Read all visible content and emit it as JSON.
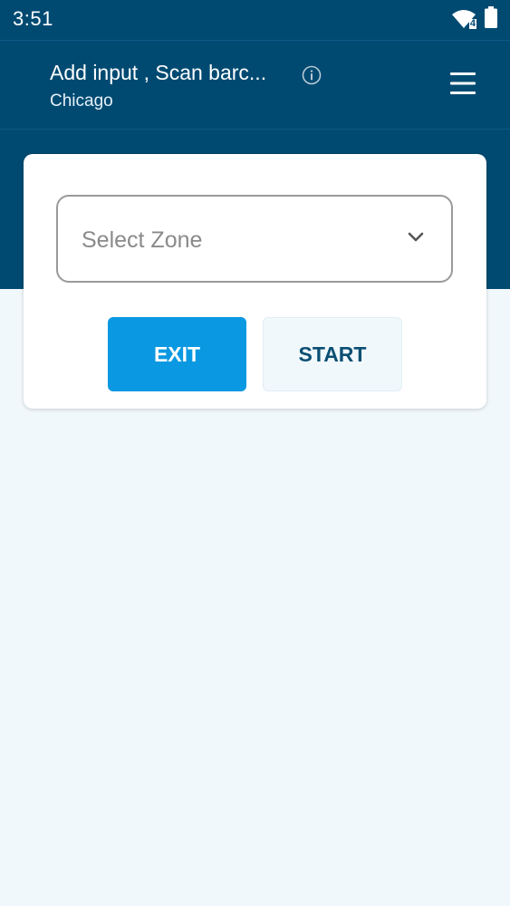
{
  "status_bar": {
    "time": "3:51",
    "network_badge": "4",
    "icons": [
      "wifi-icon",
      "battery-icon"
    ]
  },
  "app_bar": {
    "title": "Add input , Scan barc...",
    "subtitle": "Chicago",
    "icons": [
      "info-icon",
      "hamburger-menu-icon"
    ]
  },
  "form": {
    "zone_select_placeholder": "Select Zone",
    "exit_label": "EXIT",
    "start_label": "START"
  },
  "colors": {
    "header_bg": "#004a72",
    "page_bg": "#f1f8fc",
    "primary_button": "#0a98e2",
    "secondary_button_text": "#0b4f73"
  }
}
